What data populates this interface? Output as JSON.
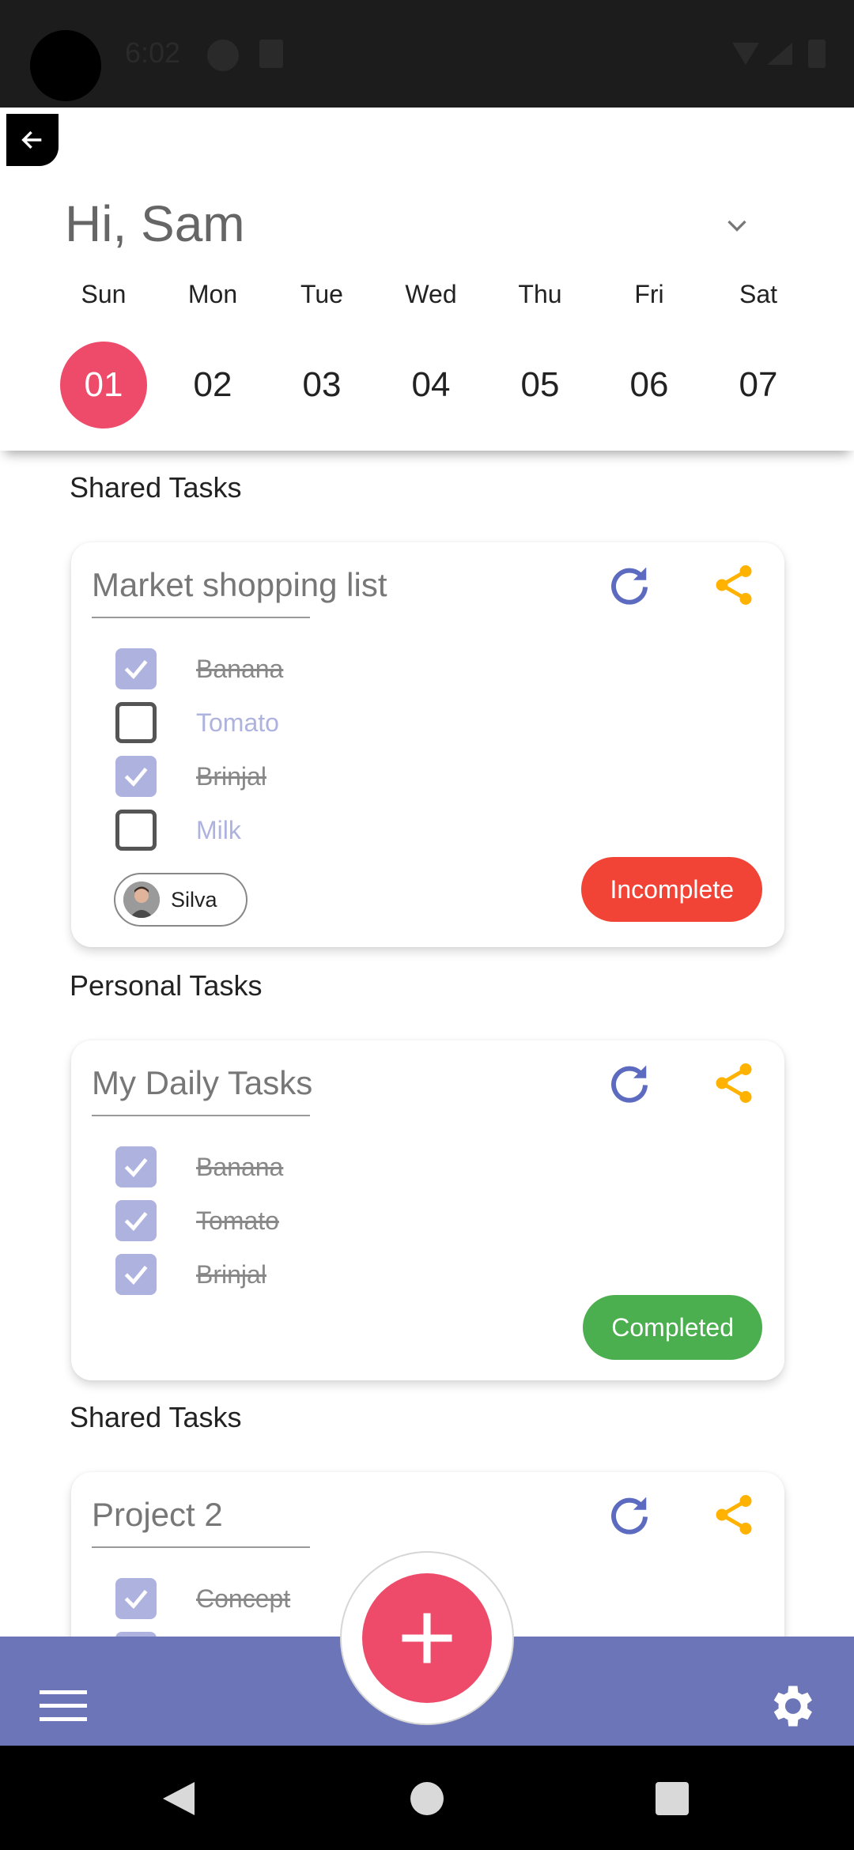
{
  "status_bar": {
    "time": "6:02"
  },
  "header": {
    "greeting": "Hi, Sam",
    "days": [
      {
        "name": "Sun",
        "num": "01",
        "active": true
      },
      {
        "name": "Mon",
        "num": "02"
      },
      {
        "name": "Tue",
        "num": "03"
      },
      {
        "name": "Wed",
        "num": "04"
      },
      {
        "name": "Thu",
        "num": "05"
      },
      {
        "name": "Fri",
        "num": "06"
      },
      {
        "name": "Sat",
        "num": "07"
      }
    ]
  },
  "sections": [
    {
      "label": "Shared Tasks"
    },
    {
      "label": "Personal Tasks"
    },
    {
      "label": "Shared Tasks"
    }
  ],
  "cards": [
    {
      "title": "Market shopping list",
      "tasks": [
        {
          "label": "Banana",
          "checked": true
        },
        {
          "label": "Tomato",
          "checked": false
        },
        {
          "label": "Brinjal",
          "checked": true
        },
        {
          "label": "Milk",
          "checked": false
        }
      ],
      "member": "Silva",
      "status": "Incomplete"
    },
    {
      "title": "My Daily Tasks",
      "tasks": [
        {
          "label": "Banana",
          "checked": true
        },
        {
          "label": "Tomato",
          "checked": true
        },
        {
          "label": "Brinjal",
          "checked": true
        }
      ],
      "status": "Completed"
    },
    {
      "title": "Project 2",
      "tasks": [
        {
          "label": "Concept",
          "checked": true
        }
      ]
    }
  ],
  "colors": {
    "accent_pink": "#ee4b6a",
    "bar_purple": "#6b75b8",
    "checkbox": "#aeb2de",
    "incomplete": "#f24436",
    "completed": "#4bae4f",
    "share": "#ffb300",
    "refresh": "#5c6bc0"
  },
  "icons": [
    "back-arrow-icon",
    "chevron-down-icon",
    "refresh-icon",
    "share-icon",
    "check-icon",
    "menu-icon",
    "settings-icon",
    "plus-icon"
  ]
}
